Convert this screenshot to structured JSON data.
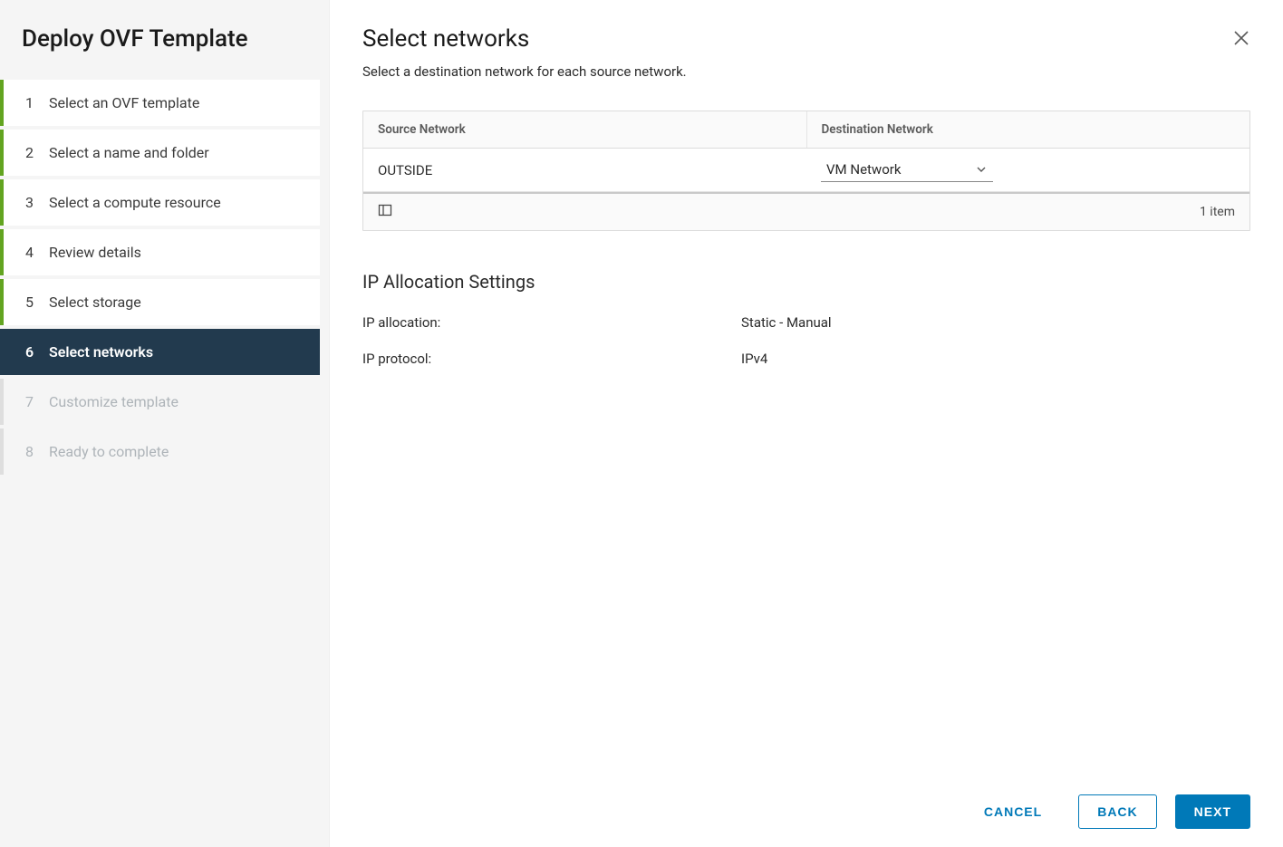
{
  "sidebar": {
    "title": "Deploy OVF Template",
    "steps": [
      {
        "num": "1",
        "label": "Select an OVF template",
        "state": "completed"
      },
      {
        "num": "2",
        "label": "Select a name and folder",
        "state": "completed"
      },
      {
        "num": "3",
        "label": "Select a compute resource",
        "state": "completed"
      },
      {
        "num": "4",
        "label": "Review details",
        "state": "completed"
      },
      {
        "num": "5",
        "label": "Select storage",
        "state": "completed"
      },
      {
        "num": "6",
        "label": "Select networks",
        "state": "active"
      },
      {
        "num": "7",
        "label": "Customize template",
        "state": "disabled"
      },
      {
        "num": "8",
        "label": "Ready to complete",
        "state": "disabled"
      }
    ]
  },
  "main": {
    "title": "Select networks",
    "subtitle": "Select a destination network for each source network.",
    "table": {
      "headers": {
        "source": "Source Network",
        "dest": "Destination Network"
      },
      "row": {
        "source": "OUTSIDE",
        "dest": "VM Network"
      },
      "footer_count": "1 item"
    },
    "ip_section": {
      "title": "IP Allocation Settings",
      "rows": [
        {
          "label": "IP allocation:",
          "value": "Static - Manual"
        },
        {
          "label": "IP protocol:",
          "value": "IPv4"
        }
      ]
    }
  },
  "footer": {
    "cancel": "CANCEL",
    "back": "BACK",
    "next": "NEXT"
  }
}
